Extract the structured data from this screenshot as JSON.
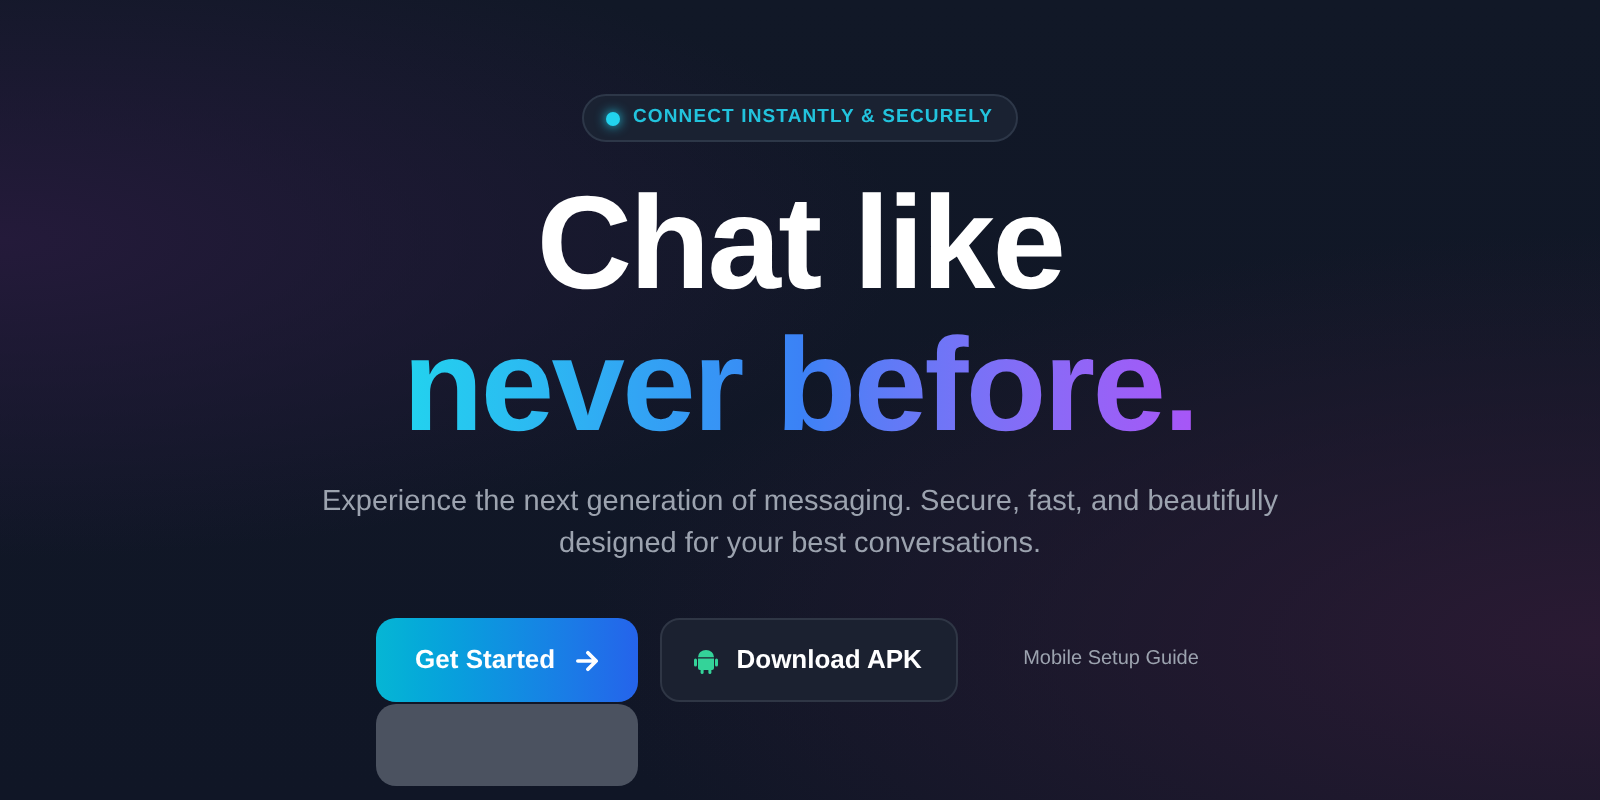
{
  "badge": {
    "label": "CONNECT INSTANTLY & SECURELY"
  },
  "headline": {
    "line_1": "Chat like",
    "line_2": "never before."
  },
  "description": "Experience the next generation of messaging. Secure, fast, and beautifully designed for your best conversations.",
  "actions": [
    {
      "kind": "primary",
      "label": "Get Started"
    },
    {
      "kind": "secondary",
      "label": "Download APK"
    },
    {
      "kind": "link",
      "label": "Mobile Setup Guide"
    }
  ]
}
